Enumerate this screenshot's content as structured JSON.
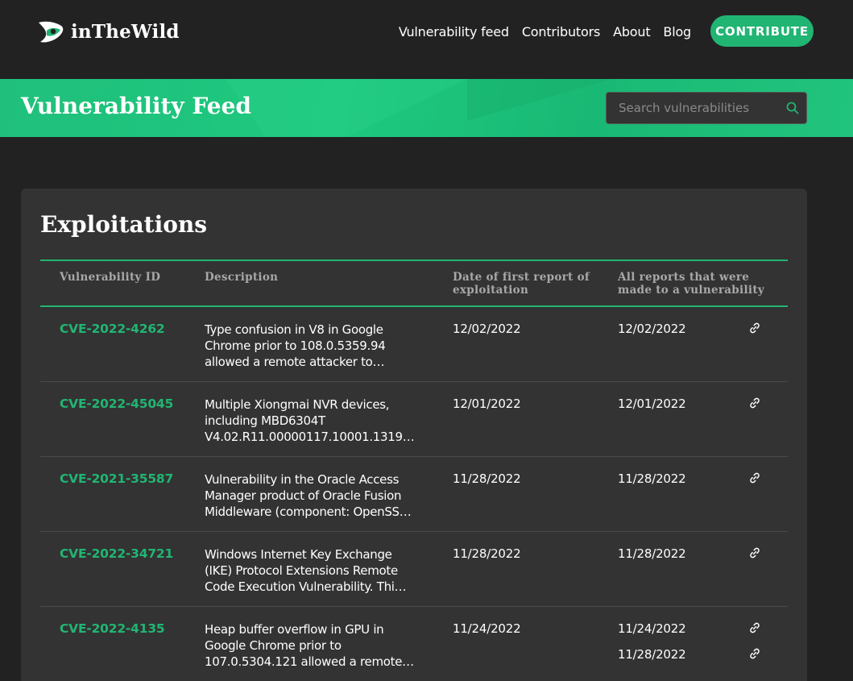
{
  "brand": {
    "name": "inTheWild",
    "logo_icon": "eye-logo-icon"
  },
  "nav": {
    "items": [
      "Vulnerability feed",
      "Contributors",
      "About",
      "Blog"
    ],
    "cta": "CONTRIBUTE"
  },
  "banner": {
    "title": "Vulnerability Feed",
    "search_placeholder": "Search vulnerabilities",
    "search_icon": "search-icon"
  },
  "card": {
    "title": "Exploitations",
    "columns": {
      "id": "Vulnerability ID",
      "description": "Description",
      "first_report": "Date of first report of exploitation",
      "all_reports": "All reports that were made to a vulnerability"
    },
    "rows": [
      {
        "id": "CVE-2022-4262",
        "description": "Type confusion in V8 in Google Chrome prior to 108.0.5359.94 allowed a remote attacker to…",
        "first_report": "12/02/2022",
        "reports": [
          "12/02/2022"
        ]
      },
      {
        "id": "CVE-2022-45045",
        "description": "Multiple Xiongmai NVR devices, including MBD6304T V4.02.R11.00000117.10001.1319…",
        "first_report": "12/01/2022",
        "reports": [
          "12/01/2022"
        ]
      },
      {
        "id": "CVE-2021-35587",
        "description": "Vulnerability in the Oracle Access Manager product of Oracle Fusion Middleware (component: OpenSS…",
        "first_report": "11/28/2022",
        "reports": [
          "11/28/2022"
        ]
      },
      {
        "id": "CVE-2022-34721",
        "description": "Windows Internet Key Exchange (IKE) Protocol Extensions Remote Code Execution Vulnerability. Thi…",
        "first_report": "11/28/2022",
        "reports": [
          "11/28/2022"
        ]
      },
      {
        "id": "CVE-2022-4135",
        "description": "Heap buffer overflow in GPU in Google Chrome prior to 107.0.5304.121 allowed a remote…",
        "first_report": "11/24/2022",
        "reports": [
          "11/24/2022",
          "11/28/2022"
        ]
      }
    ]
  },
  "colors": {
    "accent": "#21b573",
    "background": "#222222",
    "card": "#333333"
  }
}
